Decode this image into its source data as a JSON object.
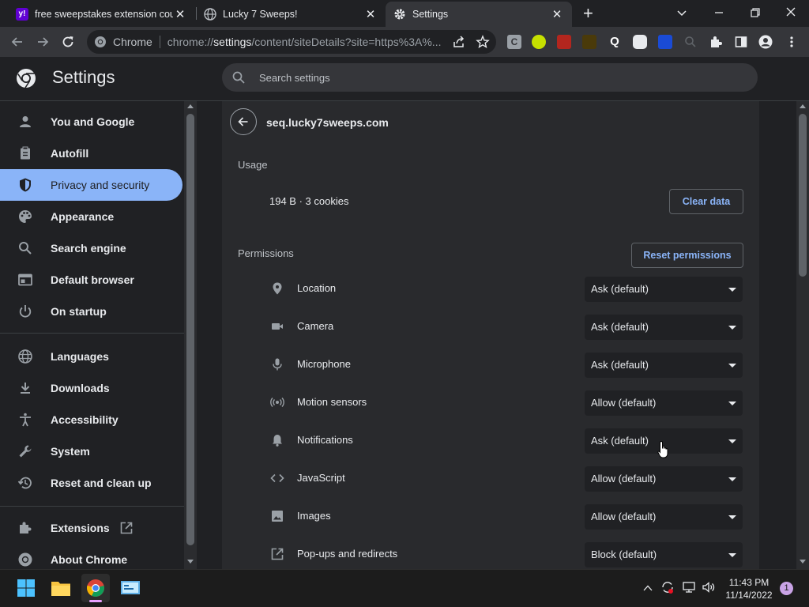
{
  "browser": {
    "tabs": [
      {
        "title": "free sweepstakes extension coup",
        "icon": "yahoo-icon",
        "active": false
      },
      {
        "title": "Lucky 7 Sweeps!",
        "icon": "globe-icon",
        "active": false
      },
      {
        "title": "Settings",
        "icon": "gear-icon",
        "active": true
      }
    ],
    "new_tab": "+",
    "omnibox": {
      "site_label": "Chrome",
      "url_prefix": "chrome://",
      "url_host": "settings",
      "url_rest": "/content/siteDetails?site=https%3A%..."
    }
  },
  "settings": {
    "title": "Settings",
    "search_placeholder": "Search settings",
    "nav": [
      {
        "label": "You and Google",
        "icon": "person-icon"
      },
      {
        "label": "Autofill",
        "icon": "clipboard-icon"
      },
      {
        "label": "Privacy and security",
        "icon": "shield-icon",
        "selected": true
      },
      {
        "label": "Appearance",
        "icon": "palette-icon"
      },
      {
        "label": "Search engine",
        "icon": "search-icon"
      },
      {
        "label": "Default browser",
        "icon": "browser-icon"
      },
      {
        "label": "On startup",
        "icon": "power-icon"
      },
      {
        "label": "Languages",
        "icon": "globe-icon"
      },
      {
        "label": "Downloads",
        "icon": "download-icon"
      },
      {
        "label": "Accessibility",
        "icon": "accessibility-icon"
      },
      {
        "label": "System",
        "icon": "wrench-icon"
      },
      {
        "label": "Reset and clean up",
        "icon": "history-icon"
      },
      {
        "label": "Extensions",
        "icon": "puzzle-icon"
      },
      {
        "label": "About Chrome",
        "icon": "chrome-icon"
      }
    ],
    "site": "seq.lucky7sweeps.com",
    "usage": {
      "heading": "Usage",
      "summary": "194 B · 3 cookies",
      "clear_button": "Clear data"
    },
    "permissions": {
      "heading": "Permissions",
      "reset_button": "Reset permissions",
      "items": [
        {
          "label": "Location",
          "value": "Ask (default)",
          "icon": "location-pin-icon"
        },
        {
          "label": "Camera",
          "value": "Ask (default)",
          "icon": "camera-icon"
        },
        {
          "label": "Microphone",
          "value": "Ask (default)",
          "icon": "microphone-icon"
        },
        {
          "label": "Motion sensors",
          "value": "Allow (default)",
          "icon": "motion-sensor-icon"
        },
        {
          "label": "Notifications",
          "value": "Ask (default)",
          "icon": "bell-icon"
        },
        {
          "label": "JavaScript",
          "value": "Allow (default)",
          "icon": "code-icon"
        },
        {
          "label": "Images",
          "value": "Allow (default)",
          "icon": "image-icon"
        },
        {
          "label": "Pop-ups and redirects",
          "value": "Block (default)",
          "icon": "open-in-new-icon"
        }
      ]
    }
  },
  "taskbar": {
    "time": "11:43 PM",
    "date": "11/14/2022",
    "notification_count": "1"
  },
  "colors": {
    "accent": "#8ab4f8",
    "background": "#202124",
    "card": "#292a2d",
    "toolbar": "#35363a"
  }
}
